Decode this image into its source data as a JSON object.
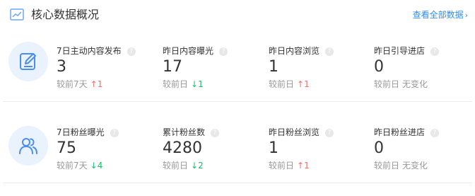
{
  "header": {
    "title": "核心数据概况",
    "link_label": "查看全部数据",
    "link_chevron": "›"
  },
  "groups": [
    {
      "icon": "edit-document-icon",
      "metrics": [
        {
          "label": "7日主动内容发布",
          "value": "3",
          "compare_prefix": "较前7天",
          "trend": "up",
          "trend_arrow": "↑",
          "trend_value": "1"
        },
        {
          "label": "昨日内容曝光",
          "value": "17",
          "compare_prefix": "较前日",
          "trend": "down",
          "trend_arrow": "↓",
          "trend_value": "1"
        },
        {
          "label": "昨日内容浏览",
          "value": "1",
          "compare_prefix": "较前日",
          "trend": "up",
          "trend_arrow": "↑",
          "trend_value": "1"
        },
        {
          "label": "昨日引导进店",
          "value": "0",
          "compare_prefix": "较前日",
          "trend": "none",
          "trend_arrow": "",
          "trend_value": "无变化"
        }
      ]
    },
    {
      "icon": "users-icon",
      "metrics": [
        {
          "label": "7日粉丝曝光",
          "value": "75",
          "compare_prefix": "较前7天",
          "trend": "down",
          "trend_arrow": "↓",
          "trend_value": "4"
        },
        {
          "label": "累计粉丝数",
          "value": "4280",
          "compare_prefix": "较前日",
          "trend": "down",
          "trend_arrow": "↓",
          "trend_value": "2"
        },
        {
          "label": "昨日粉丝浏览",
          "value": "1",
          "compare_prefix": "较前日",
          "trend": "up",
          "trend_arrow": "↑",
          "trend_value": "1"
        },
        {
          "label": "昨日粉丝进店",
          "value": "0",
          "compare_prefix": "较前日",
          "trend": "none",
          "trend_arrow": "",
          "trend_value": "无变化"
        }
      ]
    }
  ],
  "help_glyph": "?",
  "colors": {
    "accent": "#2d8cf0",
    "up": "#f26b6b",
    "down": "#19be6b",
    "avatar_bg": "#eaf2fe"
  }
}
